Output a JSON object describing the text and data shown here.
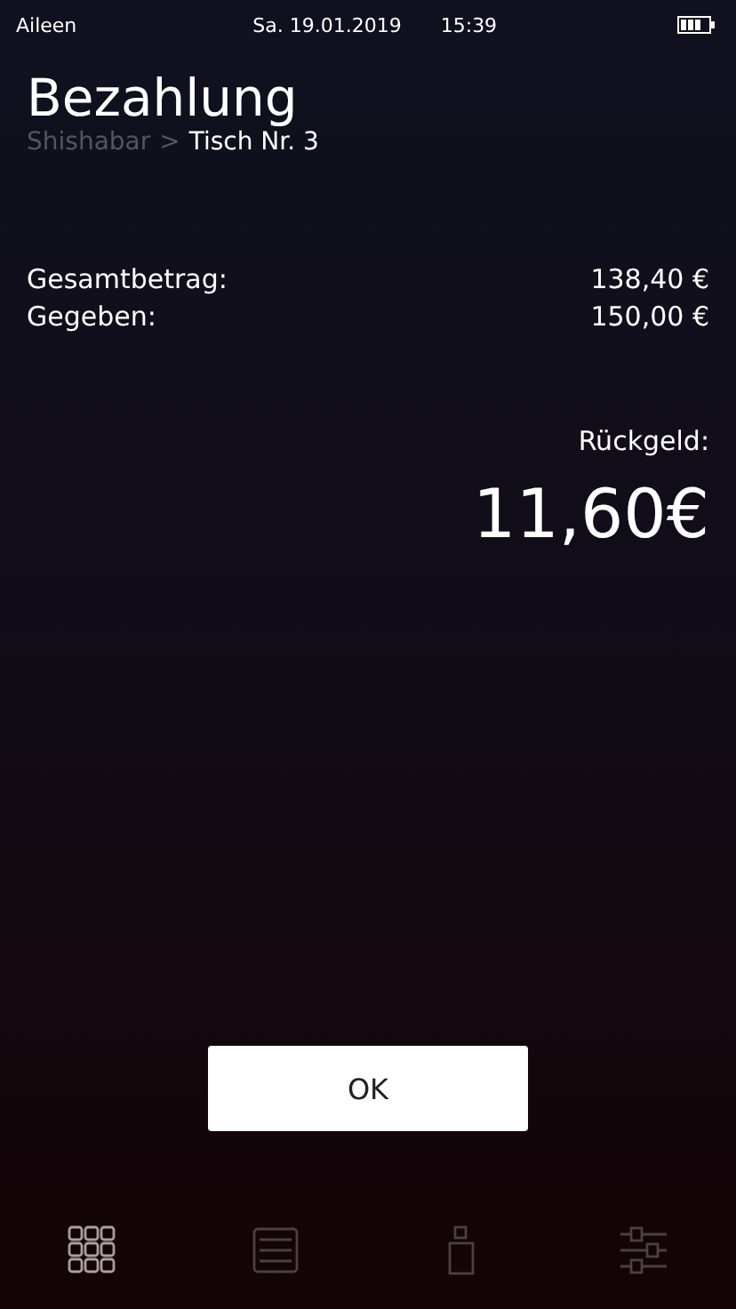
{
  "status_bar": {
    "user": "Aileen",
    "date": "Sa. 19.01.2019",
    "time": "15:39"
  },
  "header": {
    "title": "Bezahlung",
    "breadcrumb": [
      {
        "label": "Shishabar",
        "current": false
      },
      {
        "label": ">",
        "current": false
      },
      {
        "label": "Tisch Nr. 3",
        "current": true
      }
    ]
  },
  "summary": [
    {
      "label": "Gesamtbetrag:",
      "value": "138,40 €"
    },
    {
      "label": "Gegeben:",
      "value": "150,00 €"
    }
  ],
  "change": {
    "label": "Rückgeld:",
    "amount": "11,60€"
  },
  "ok_button": "OK",
  "tabs": [
    {
      "kind": "grid",
      "selected": true
    },
    {
      "kind": "list",
      "selected": false
    },
    {
      "kind": "bottle",
      "selected": false
    },
    {
      "kind": "sliders",
      "selected": false
    }
  ]
}
